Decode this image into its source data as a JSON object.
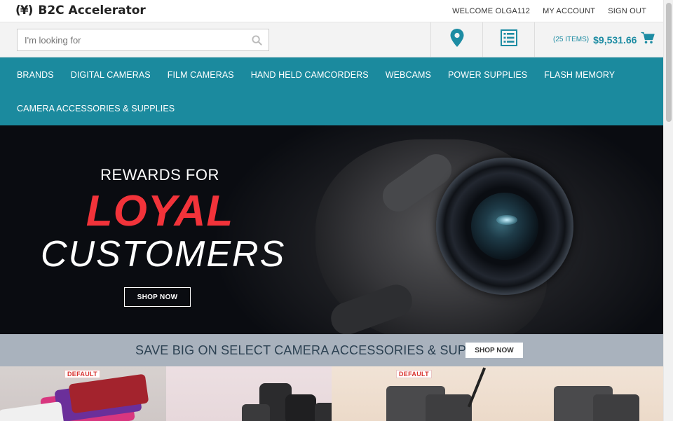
{
  "header": {
    "logo_mark": "(¥)",
    "logo_text": "B2C Accelerator",
    "welcome": "WELCOME OLGA112",
    "my_account": "MY ACCOUNT",
    "sign_out": "SIGN OUT"
  },
  "search": {
    "placeholder": "I'm looking for",
    "icon": "search-icon"
  },
  "utilities": {
    "location_icon": "map-pin-icon",
    "list_icon": "list-icon",
    "cart_items": "(25 ITEMS)",
    "cart_total": "$9,531.66",
    "cart_icon": "cart-icon"
  },
  "nav": {
    "row1": [
      "BRANDS",
      "DIGITAL CAMERAS",
      "FILM CAMERAS",
      "HAND HELD CAMCORDERS",
      "WEBCAMS",
      "POWER SUPPLIES",
      "FLASH MEMORY"
    ],
    "row2": [
      "CAMERA ACCESSORIES & SUPPLIES"
    ]
  },
  "hero": {
    "line1": "REWARDS FOR",
    "line2": "LOYAL",
    "line3": "CUSTOMERS",
    "button": "SHOP NOW"
  },
  "promo": {
    "text": "SAVE BIG ON SELECT CAMERA ACCESSORIES & SUPPLIES",
    "button": "SHOP NOW"
  },
  "tiles": {
    "badge1": "DEFAULT",
    "badge3": "DEFAULT"
  },
  "colors": {
    "nav": "#1b8a9e",
    "accent": "#1d8ca3",
    "loyal": "#f2333a",
    "promo_band": "#a9b2bd"
  }
}
